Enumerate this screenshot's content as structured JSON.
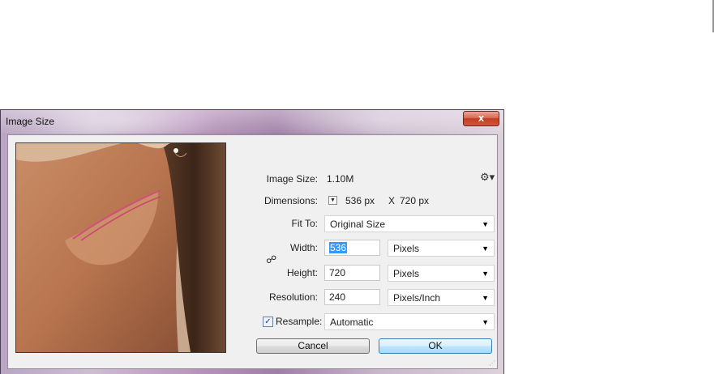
{
  "window": {
    "title": "Image Size",
    "close_symbol": "x"
  },
  "info": {
    "image_size_label": "Image Size:",
    "image_size_value": "1.10M",
    "dimensions_label": "Dimensions:",
    "dimensions_width": "536 px",
    "dimensions_sep": "X",
    "dimensions_height": "720 px"
  },
  "fit_to": {
    "label": "Fit To:",
    "value": "Original Size"
  },
  "width": {
    "label": "Width:",
    "value": "536",
    "unit": "Pixels"
  },
  "height": {
    "label": "Height:",
    "value": "720",
    "unit": "Pixels"
  },
  "resolution": {
    "label": "Resolution:",
    "value": "240",
    "unit": "Pixels/Inch"
  },
  "resample": {
    "label": "Resample:",
    "checked": true,
    "value": "Automatic"
  },
  "buttons": {
    "cancel": "Cancel",
    "ok": "OK"
  },
  "icons": {
    "gear": "gear-icon",
    "chain": "chain-link-icon",
    "dropdown": "chevron-down-icon",
    "checkbox": "checkmark-icon"
  }
}
